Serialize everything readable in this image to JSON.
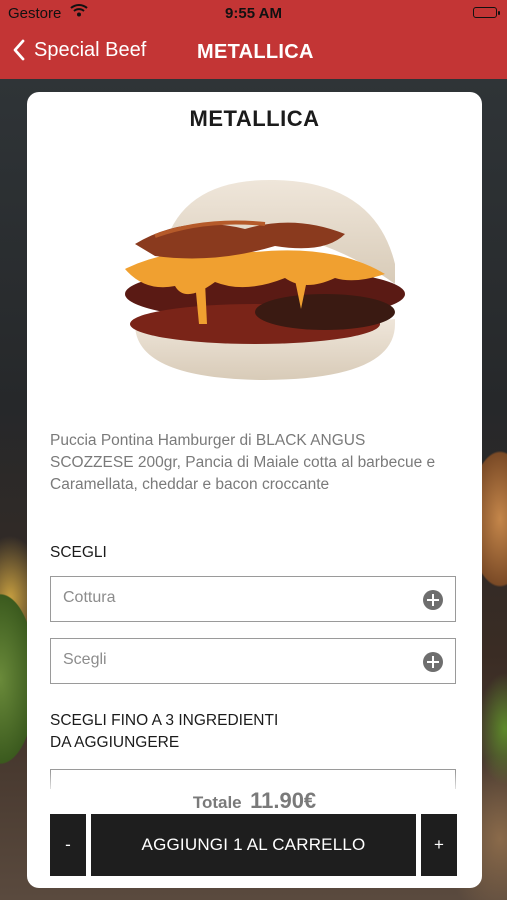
{
  "status_bar": {
    "carrier": "Gestore",
    "time": "9:55 AM"
  },
  "nav": {
    "back_label": "Special Beef",
    "title": "METALLICA"
  },
  "product": {
    "name": "METALLICA",
    "description": "Puccia Pontina Hamburger di BLACK ANGUS SCOZZESE 200gr, Pancia di Maiale cotta al barbecue e Caramellata, cheddar e bacon croccante"
  },
  "options": {
    "section_label": "SCEGLI",
    "fields": [
      {
        "placeholder": "Cottura"
      },
      {
        "placeholder": "Scegli"
      }
    ]
  },
  "ingredients": {
    "section_label_line1": "SCEGLI FINO A 3 INGREDIENTI",
    "section_label_line2": "DA AGGIUNGERE"
  },
  "footer": {
    "total_label": "Totale",
    "total_amount": "11.90€",
    "minus_label": "-",
    "add_label": "AGGIUNGI 1 AL CARRELLO",
    "plus_label": "+"
  },
  "colors": {
    "header": "#c33535",
    "button": "#1e1e1e"
  }
}
